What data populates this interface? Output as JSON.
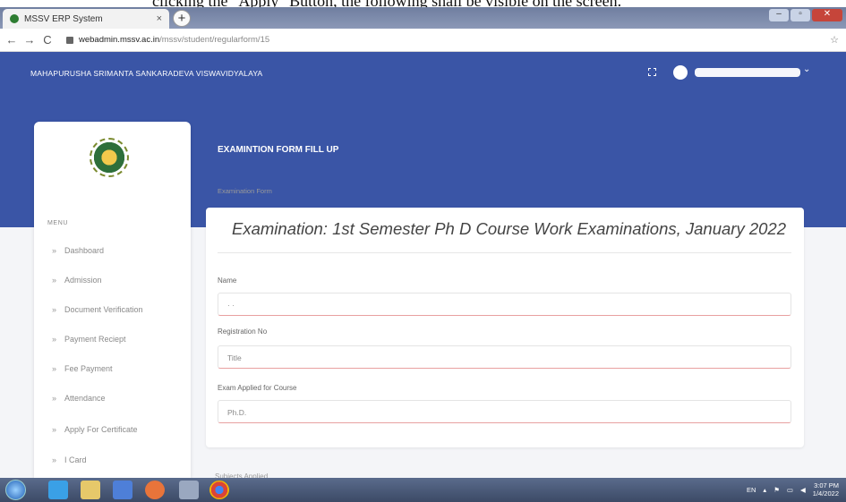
{
  "caption": "clicking the \"Apply\" Button, the following shall be visible on the screen.",
  "browser": {
    "tab_title": "MSSV ERP System",
    "tab_close": "×",
    "new_tab": "+",
    "url_domain": "webadmin.mssv.ac.in",
    "url_path": "/mssv/student/regularform/15",
    "back": "←",
    "forward": "→",
    "reload": "C",
    "star": "☆"
  },
  "header": {
    "site_title": "MAHAPURUSHA SRIMANTA SANKARADEVA VISWAVIDYALAYA",
    "page_title": "EXAMINTION FORM FILL UP",
    "caret": "⌄"
  },
  "sidebar": {
    "menu_label": "MENU",
    "chevron": "»",
    "items": [
      {
        "label": "Dashboard"
      },
      {
        "label": "Admission"
      },
      {
        "label": "Document Verification"
      },
      {
        "label": "Payment Reciept"
      },
      {
        "label": "Fee Payment"
      },
      {
        "label": "Attendance"
      },
      {
        "label": "Apply For Certificate"
      },
      {
        "label": "I Card"
      }
    ]
  },
  "main": {
    "breadcrumb": "Examination Form",
    "exam_heading": "Examination: 1st Semester Ph D Course Work Examinations, January 2022",
    "fields": [
      {
        "label": "Name",
        "value": "· ·"
      },
      {
        "label": "Registration No",
        "value": "Title"
      },
      {
        "label": "Exam Applied for Course",
        "value": "Ph.D."
      }
    ],
    "subjects_label": "Subjects Applied"
  },
  "taskbar": {
    "lang": "EN",
    "time": "3:07 PM",
    "date": "1/4/2022"
  },
  "colors": {
    "header_blue": "#3a55a6",
    "field_underline": "#e8a0a0"
  }
}
